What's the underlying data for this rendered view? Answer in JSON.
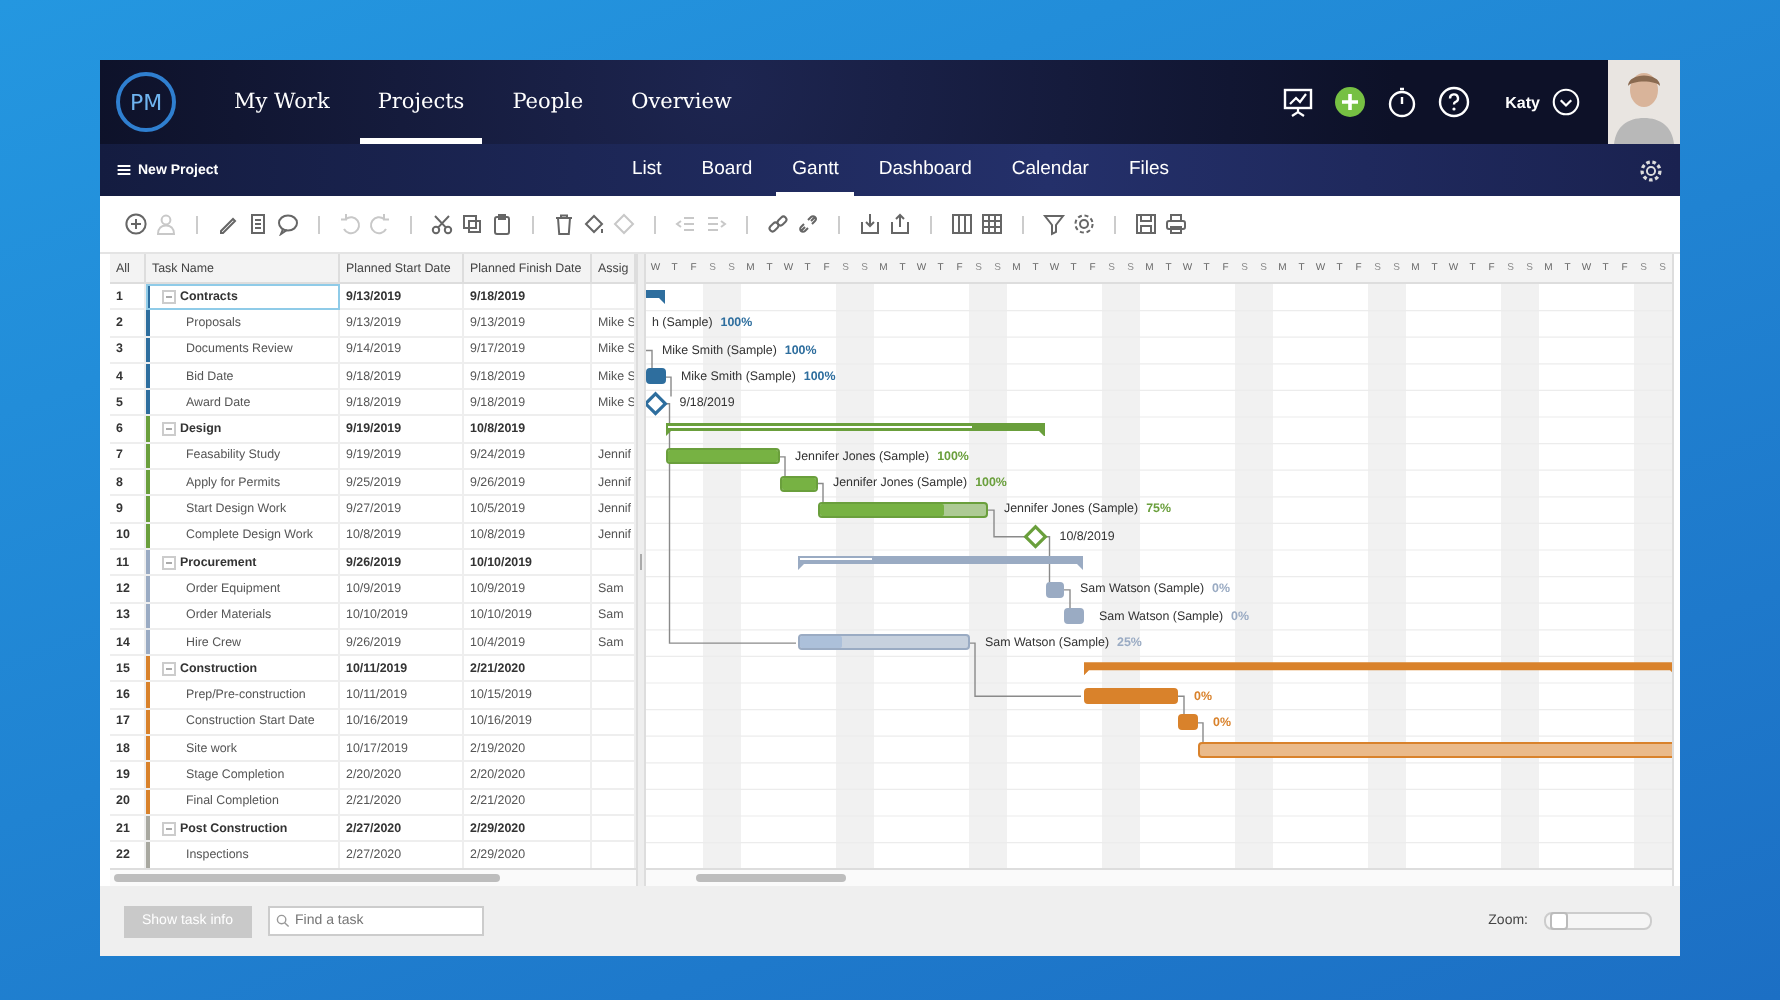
{
  "app": {
    "logo": "PM",
    "nav": [
      {
        "label": "My Work",
        "selected": false
      },
      {
        "label": "Projects",
        "selected": true
      },
      {
        "label": "People",
        "selected": false
      },
      {
        "label": "Overview",
        "selected": false
      }
    ],
    "user": "Katy"
  },
  "subnav": {
    "menu_label": "New Project",
    "tabs": [
      {
        "label": "List",
        "selected": false
      },
      {
        "label": "Board",
        "selected": false
      },
      {
        "label": "Gantt",
        "selected": true
      },
      {
        "label": "Dashboard",
        "selected": false
      },
      {
        "label": "Calendar",
        "selected": false
      },
      {
        "label": "Files",
        "selected": false
      }
    ]
  },
  "toolbar": [
    {
      "tools": [
        {
          "kind": "add",
          "disabled": false
        },
        {
          "kind": "assign",
          "disabled": true
        }
      ]
    },
    {
      "tools": [
        {
          "kind": "edit",
          "disabled": false
        },
        {
          "kind": "notes",
          "disabled": false
        },
        {
          "kind": "comment",
          "disabled": false
        }
      ]
    },
    {
      "tools": [
        {
          "kind": "undo",
          "disabled": true
        },
        {
          "kind": "redo",
          "disabled": true
        }
      ]
    },
    {
      "tools": [
        {
          "kind": "cut",
          "disabled": false
        },
        {
          "kind": "copy",
          "disabled": false
        },
        {
          "kind": "paste",
          "disabled": false
        }
      ]
    },
    {
      "tools": [
        {
          "kind": "delete",
          "disabled": false
        },
        {
          "kind": "fill",
          "disabled": false
        },
        {
          "kind": "milestone",
          "disabled": true
        }
      ]
    },
    {
      "tools": [
        {
          "kind": "outdent",
          "disabled": true
        },
        {
          "kind": "indent",
          "disabled": true
        }
      ]
    },
    {
      "tools": [
        {
          "kind": "link",
          "disabled": false
        },
        {
          "kind": "unlink",
          "disabled": false
        }
      ]
    },
    {
      "tools": [
        {
          "kind": "import",
          "disabled": false
        },
        {
          "kind": "export",
          "disabled": false
        }
      ]
    },
    {
      "tools": [
        {
          "kind": "columns",
          "disabled": false
        },
        {
          "kind": "grid",
          "disabled": false
        }
      ]
    },
    {
      "tools": [
        {
          "kind": "filter",
          "disabled": false
        },
        {
          "kind": "settings",
          "disabled": false
        }
      ]
    },
    {
      "tools": [
        {
          "kind": "save",
          "disabled": false
        },
        {
          "kind": "print",
          "disabled": false
        }
      ]
    }
  ],
  "table": {
    "columns": [
      "All",
      "Task Name",
      "Planned Start Date",
      "Planned Finish Date",
      "Assig"
    ],
    "groups": [
      {
        "num": "1",
        "name": "Contracts",
        "start": "9/13/2019",
        "finish": "9/18/2019",
        "color": "#2e6e9e",
        "expanded": true,
        "selected": true,
        "children": [
          {
            "num": "2",
            "name": "Proposals",
            "start": "9/13/2019",
            "finish": "9/13/2019",
            "assignee": "Mike S",
            "kind": "task",
            "selected": false,
            "bar_label": "h (Sample)",
            "percent": "100%"
          },
          {
            "num": "3",
            "name": "Documents Review",
            "start": "9/14/2019",
            "finish": "9/17/2019",
            "assignee": "Mike S",
            "kind": "task",
            "selected": false,
            "bar_label": "Mike Smith (Sample)",
            "percent": "100%"
          },
          {
            "num": "4",
            "name": "Bid Date",
            "start": "9/18/2019",
            "finish": "9/18/2019",
            "assignee": "Mike S",
            "kind": "task",
            "selected": false,
            "bar_label": "Mike Smith (Sample)",
            "percent": "100%"
          },
          {
            "num": "5",
            "name": "Award Date",
            "start": "9/18/2019",
            "finish": "9/18/2019",
            "assignee": "Mike S",
            "kind": "milestone",
            "selected": false,
            "bar_label": "9/18/2019"
          }
        ]
      },
      {
        "num": "6",
        "name": "Design",
        "start": "9/19/2019",
        "finish": "10/8/2019",
        "color": "#6a9f3c",
        "expanded": true,
        "selected": false,
        "level": 0.8,
        "children": [
          {
            "num": "7",
            "name": "Feasability Study",
            "start": "9/19/2019",
            "finish": "9/24/2019",
            "assignee": "Jennif",
            "kind": "task",
            "selected": false,
            "level": 1,
            "bar_label": "Jennifer Jones (Sample)",
            "percent": "100%"
          },
          {
            "num": "8",
            "name": "Apply for Permits",
            "start": "9/25/2019",
            "finish": "9/26/2019",
            "assignee": "Jennif",
            "kind": "task",
            "selected": false,
            "level": 1,
            "bar_label": "Jennifer Jones (Sample)",
            "percent": "100%"
          },
          {
            "num": "9",
            "name": "Start Design Work",
            "start": "9/27/2019",
            "finish": "10/5/2019",
            "assignee": "Jennif",
            "kind": "task",
            "selected": false,
            "level": 0.75,
            "bar_label": "Jennifer Jones (Sample)",
            "percent": "75%"
          },
          {
            "num": "10",
            "name": "Complete Design Work",
            "start": "10/8/2019",
            "finish": "10/8/2019",
            "assignee": "Jennif",
            "kind": "milestone",
            "selected": false,
            "bar_label": "10/8/2019"
          }
        ]
      },
      {
        "num": "11",
        "name": "Procurement",
        "start": "9/26/2019",
        "finish": "10/10/2019",
        "color": "#9aabc3",
        "expanded": true,
        "selected": false,
        "level": 0.25,
        "children": [
          {
            "num": "12",
            "name": "Order Equipment",
            "start": "10/9/2019",
            "finish": "10/9/2019",
            "assignee": "Sam",
            "kind": "task",
            "selected": false,
            "bar_label": "Sam Watson (Sample)",
            "percent": "0%"
          },
          {
            "num": "13",
            "name": "Order Materials",
            "start": "10/10/2019",
            "finish": "10/10/2019",
            "assignee": "Sam",
            "kind": "task",
            "selected": false,
            "bar_label": "Sam Watson (Sample)",
            "percent": "0%"
          },
          {
            "num": "14",
            "name": "Hire Crew",
            "start": "9/26/2019",
            "finish": "10/4/2019",
            "assignee": "Sam",
            "kind": "task",
            "selected": false,
            "level": 0.25,
            "bar_label": "Sam Watson (Sample)",
            "percent": "25%"
          }
        ]
      },
      {
        "num": "15",
        "name": "Construction",
        "start": "10/11/2019",
        "finish": "2/21/2020",
        "color": "#d9822b",
        "expanded": true,
        "selected": false,
        "children": [
          {
            "num": "16",
            "name": "Prep/Pre-construction",
            "start": "10/11/2019",
            "finish": "10/15/2019",
            "kind": "task",
            "selected": false,
            "percent": "0%"
          },
          {
            "num": "17",
            "name": "Construction Start Date",
            "start": "10/16/2019",
            "finish": "10/16/2019",
            "kind": "task",
            "selected": false,
            "percent": "0%"
          },
          {
            "num": "18",
            "name": "Site work",
            "start": "10/17/2019",
            "finish": "2/19/2020",
            "kind": "task",
            "selected": false
          },
          {
            "num": "19",
            "name": "Stage Completion",
            "start": "2/20/2020",
            "finish": "2/20/2020",
            "kind": "milestone",
            "selected": false
          },
          {
            "num": "20",
            "name": "Final Completion",
            "start": "2/21/2020",
            "finish": "2/21/2020",
            "kind": "milestone",
            "selected": false
          }
        ]
      },
      {
        "num": "21",
        "name": "Post Construction",
        "start": "2/27/2020",
        "finish": "2/29/2020",
        "color": "#a8a8a0",
        "expanded": true,
        "selected": false,
        "children": [
          {
            "num": "22",
            "name": "Inspections",
            "start": "2/27/2020",
            "finish": "2/29/2020",
            "kind": "task",
            "selected": false
          }
        ]
      }
    ]
  },
  "gantt": {
    "days": [
      {
        "letter": "W",
        "weekend": false
      },
      {
        "letter": "T",
        "weekend": false
      },
      {
        "letter": "F",
        "weekend": false
      },
      {
        "letter": "S",
        "weekend": true
      },
      {
        "letter": "S",
        "weekend": true
      },
      {
        "letter": "M",
        "weekend": false
      },
      {
        "letter": "T",
        "weekend": false
      },
      {
        "letter": "W",
        "weekend": false
      },
      {
        "letter": "T",
        "weekend": false
      },
      {
        "letter": "F",
        "weekend": false
      },
      {
        "letter": "S",
        "weekend": true
      },
      {
        "letter": "S",
        "weekend": true
      },
      {
        "letter": "M",
        "weekend": false
      },
      {
        "letter": "T",
        "weekend": false
      },
      {
        "letter": "W",
        "weekend": false
      },
      {
        "letter": "T",
        "weekend": false
      },
      {
        "letter": "F",
        "weekend": false
      },
      {
        "letter": "S",
        "weekend": true
      },
      {
        "letter": "S",
        "weekend": true
      },
      {
        "letter": "M",
        "weekend": false
      },
      {
        "letter": "T",
        "weekend": false
      },
      {
        "letter": "W",
        "weekend": false
      },
      {
        "letter": "T",
        "weekend": false
      },
      {
        "letter": "F",
        "weekend": false
      },
      {
        "letter": "S",
        "weekend": true
      },
      {
        "letter": "S",
        "weekend": true
      },
      {
        "letter": "M",
        "weekend": false
      },
      {
        "letter": "T",
        "weekend": false
      },
      {
        "letter": "W",
        "weekend": false
      },
      {
        "letter": "T",
        "weekend": false
      },
      {
        "letter": "F",
        "weekend": false
      },
      {
        "letter": "S",
        "weekend": true
      },
      {
        "letter": "S",
        "weekend": true
      },
      {
        "letter": "M",
        "weekend": false
      },
      {
        "letter": "T",
        "weekend": false
      },
      {
        "letter": "W",
        "weekend": false
      },
      {
        "letter": "T",
        "weekend": false
      },
      {
        "letter": "F",
        "weekend": false
      },
      {
        "letter": "S",
        "weekend": true
      },
      {
        "letter": "S",
        "weekend": true
      },
      {
        "letter": "M",
        "weekend": false
      },
      {
        "letter": "T",
        "weekend": false
      },
      {
        "letter": "W",
        "weekend": false
      },
      {
        "letter": "T",
        "weekend": false
      },
      {
        "letter": "F",
        "weekend": false
      },
      {
        "letter": "S",
        "weekend": true
      },
      {
        "letter": "S",
        "weekend": true
      },
      {
        "letter": "M",
        "weekend": false
      },
      {
        "letter": "T",
        "weekend": false
      },
      {
        "letter": "W",
        "weekend": false
      },
      {
        "letter": "T",
        "weekend": false
      },
      {
        "letter": "F",
        "weekend": false
      },
      {
        "letter": "S",
        "weekend": true
      },
      {
        "letter": "S",
        "weekend": true
      }
    ]
  },
  "footer": {
    "show_info": {
      "label": "Show task info",
      "disabled": true
    },
    "search_placeholder": "Find a task",
    "zoom": {
      "label": "Zoom:",
      "level": 0.05
    }
  }
}
